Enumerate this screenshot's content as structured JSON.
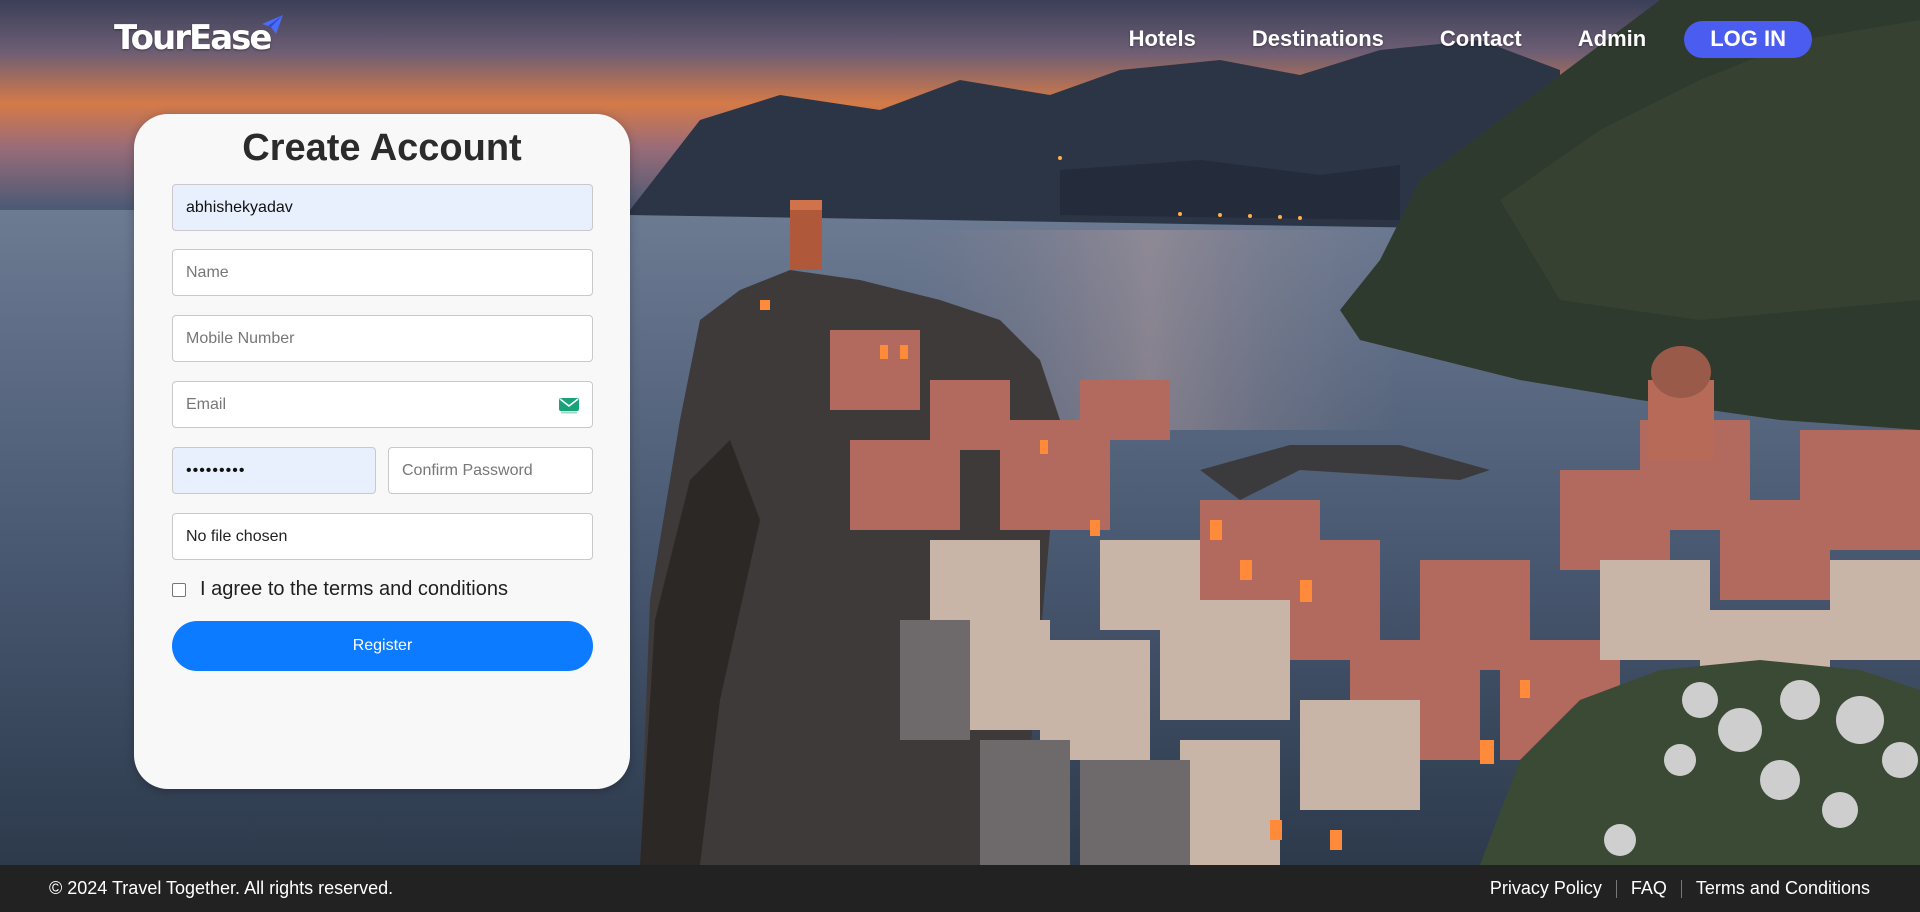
{
  "header": {
    "logo_text": "TourEase",
    "nav": {
      "hotels": "Hotels",
      "destinations": "Destinations",
      "contact": "Contact",
      "admin": "Admin",
      "login": "LOG IN"
    }
  },
  "form": {
    "title": "Create Account",
    "username_value": "abhishekyadav",
    "name_placeholder": "Name",
    "mobile_placeholder": "Mobile Number",
    "email_placeholder": "Email",
    "password_value": "•••••••••",
    "confirm_placeholder": "Confirm Password",
    "file_status": "No file chosen",
    "terms_label": "I agree to the terms and conditions",
    "terms_checked": false,
    "register_label": "Register"
  },
  "footer": {
    "copyright": "© 2024 Travel Together. All rights reserved.",
    "links": {
      "privacy": "Privacy Policy",
      "faq": "FAQ",
      "terms": "Terms and Conditions"
    }
  },
  "colors": {
    "accent_login": "#4b5cf0",
    "accent_register": "#0d7bff",
    "card_bg": "#f8f8f8",
    "footer_bg": "#222222",
    "autofill_bg": "#e8f0fe"
  },
  "icons": {
    "logo_plane": "paper-plane-icon",
    "email_field": "email-envelope-icon"
  }
}
